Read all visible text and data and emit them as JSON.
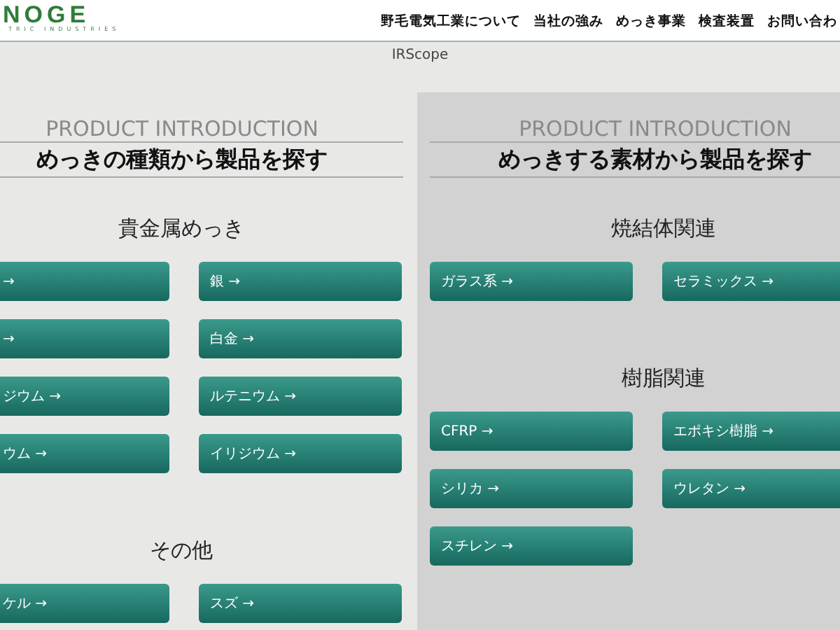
{
  "header": {
    "logo": {
      "wordmark": "NOGE",
      "tagline": "TRIC INDUSTRIES"
    },
    "nav": [
      "野毛電気工業について",
      "当社の強み",
      "めっき事業",
      "検査装置",
      "お問い合わ"
    ]
  },
  "page_title": "IRScope",
  "panels": [
    {
      "eyebrow": "PRODUCT INTRODUCTION",
      "heading": "めっきの種類から製品を探す",
      "sections": [
        {
          "title": "貴金属めっき",
          "buttons": [
            "→",
            "銀 →",
            "→",
            "白金 →",
            "ジウム →",
            "ルテニウム →",
            "ウム →",
            "イリジウム →"
          ]
        },
        {
          "title": "その他",
          "buttons": [
            "ケル →",
            "スズ →"
          ]
        }
      ]
    },
    {
      "eyebrow": "PRODUCT INTRODUCTION",
      "heading": "めっきする素材から製品を探す",
      "sections": [
        {
          "title": "焼結体関連",
          "buttons": [
            "ガラス系 →",
            "セラミックス →"
          ]
        },
        {
          "title": "樹脂関連",
          "buttons": [
            "CFRP →",
            "エポキシ樹脂 →",
            "シリカ →",
            "ウレタン →",
            "スチレン →"
          ]
        }
      ]
    }
  ]
}
